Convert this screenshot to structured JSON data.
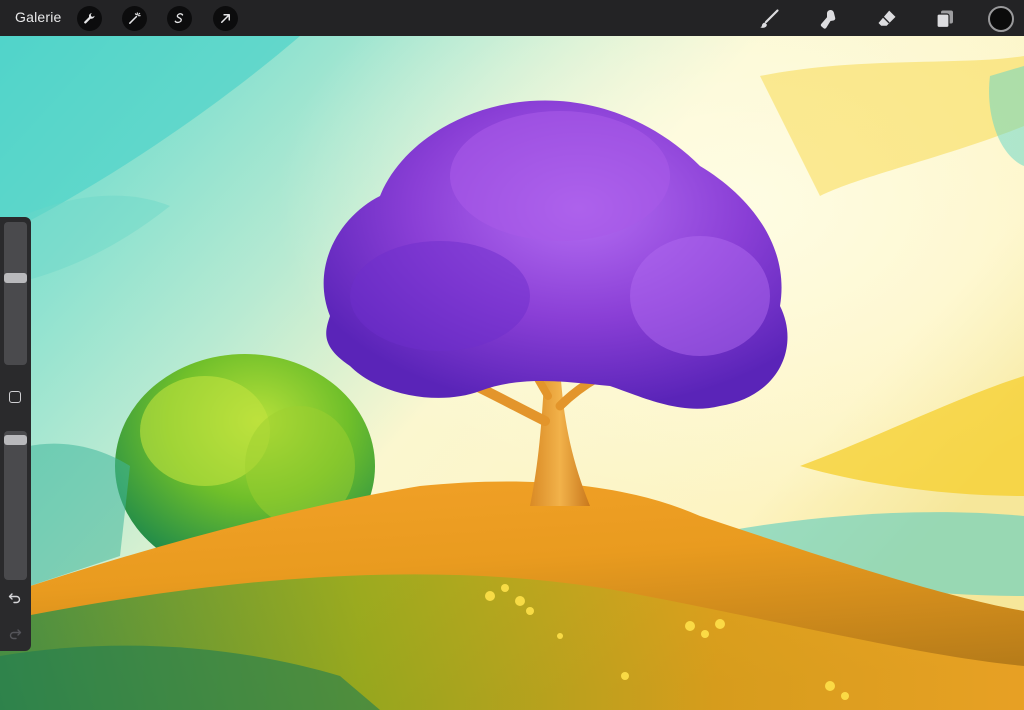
{
  "topbar": {
    "gallery_label": "Galerie",
    "actions": [
      {
        "name": "actions-wrench-icon"
      },
      {
        "name": "adjustments-magic-wand-icon"
      },
      {
        "name": "selection-s-icon"
      },
      {
        "name": "transform-arrow-icon"
      }
    ],
    "tools": [
      {
        "name": "brush-icon"
      },
      {
        "name": "smudge-icon"
      },
      {
        "name": "eraser-icon"
      },
      {
        "name": "layers-icon"
      }
    ],
    "current_color": "#0b0b0b"
  },
  "sidebar": {
    "brush_size_level": 0.38,
    "opacity_level": 0.03
  },
  "colors": {
    "sky_teal": "#5fd9cd",
    "sky_cream": "#fbf7cf",
    "tree_purple": "#8a3fd6",
    "trunk_orange": "#e79a32",
    "bush_green": "#6fbf2a",
    "hill_orange": "#f0a021"
  }
}
